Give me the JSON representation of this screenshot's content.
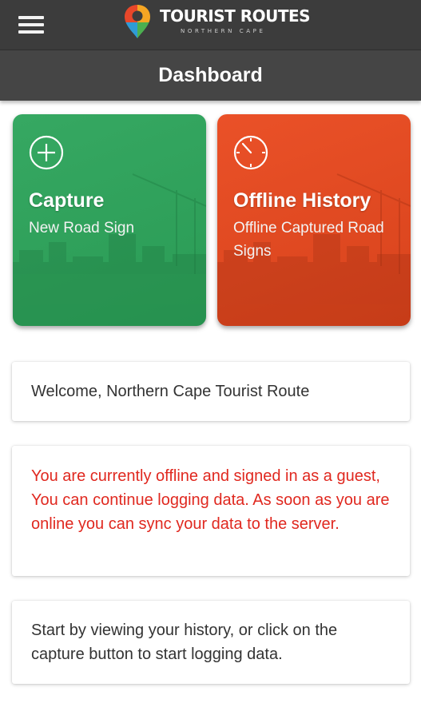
{
  "header": {
    "logo_title": "TOURIST ROUTES",
    "logo_subtitle": "NORTHERN CAPE",
    "menu_icon": "hamburger-menu-icon",
    "logo_icon": "location-pin-icon",
    "background_color": "#3c3c3c"
  },
  "titlebar": {
    "title": "Dashboard",
    "background_color": "#454545"
  },
  "tiles": [
    {
      "label": "Capture",
      "subtitle": "New Road Sign",
      "icon": "plus-circle-icon",
      "color": "#2a9b55"
    },
    {
      "label": "Offline History",
      "subtitle": "Offline Captured Road Signs",
      "icon": "timer-icon",
      "color": "#d8431c"
    }
  ],
  "cards": {
    "welcome": "Welcome, Northern Cape Tourist Route",
    "offline_notice": "You are currently offline and signed in as a guest, You can continue logging data. As soon as you are online you can sync your data to the server.",
    "instructions": "Start by viewing your history, or click on the capture button to start logging data.",
    "notice_color": "#e0281f"
  }
}
